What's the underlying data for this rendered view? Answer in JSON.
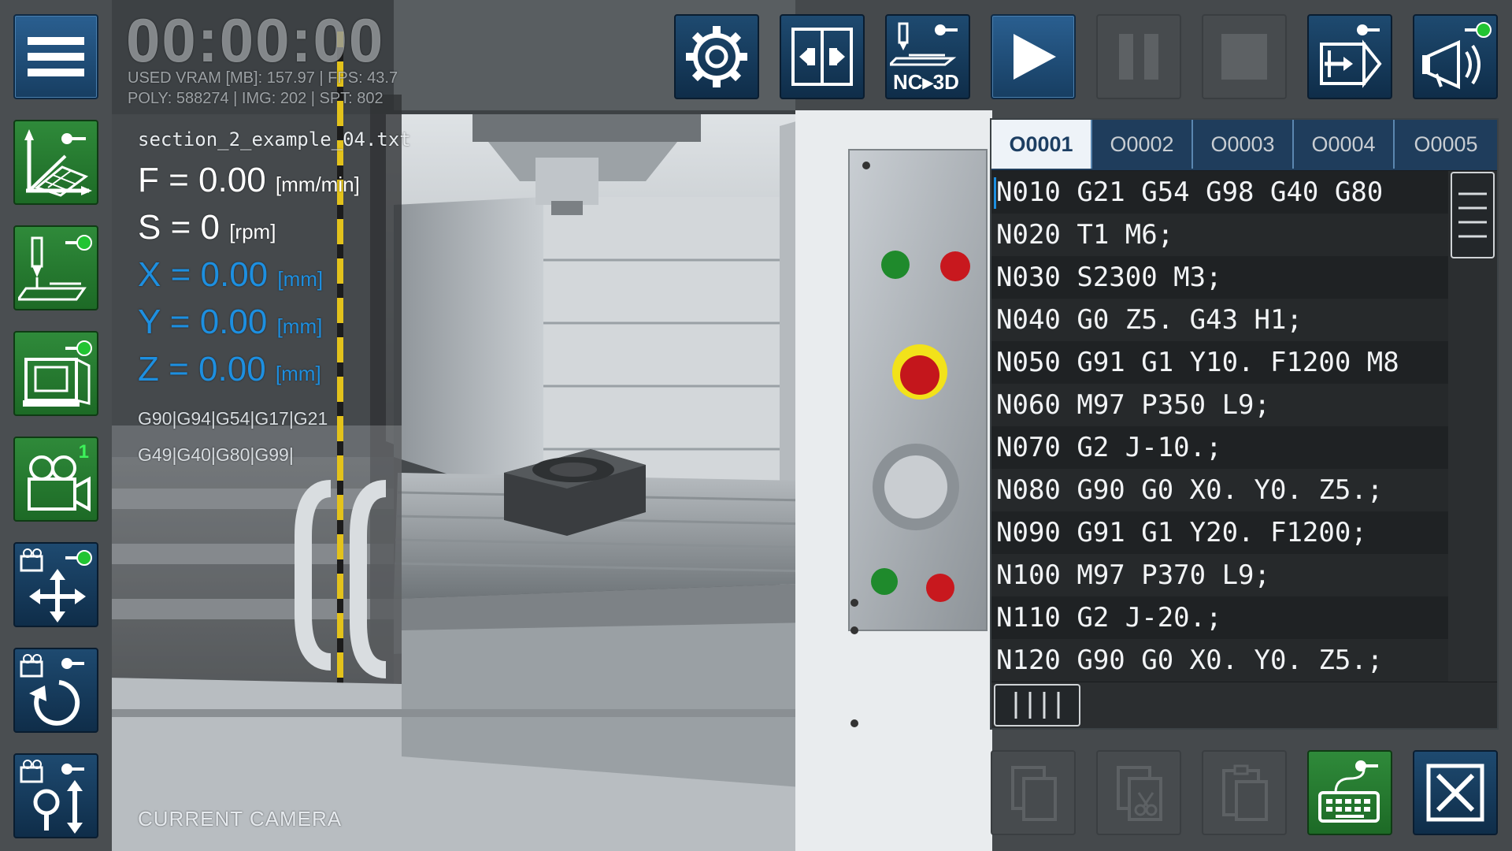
{
  "app": {
    "timer": "00:00:00",
    "stats": {
      "line1": "USED VRAM [MB]: 157.97 | FPS: 43.7",
      "line2": "POLY: 588274 | IMG: 202 | SPT: 802"
    }
  },
  "readout": {
    "filename": "section_2_example_04.txt",
    "f_label": "F = 0.00",
    "f_unit": "[mm/min]",
    "s_label": "S = 0",
    "s_unit": "[rpm]",
    "x_label": "X = 0.00",
    "x_unit": "[mm]",
    "y_label": "Y = 0.00",
    "y_unit": "[mm]",
    "z_label": "Z = 0.00",
    "z_unit": "[mm]",
    "gcodes_1": "G90|G94|G54|G17|G21",
    "gcodes_2": "G49|G40|G80|G99|",
    "camera_label": "CURRENT CAMERA"
  },
  "toolbar": {
    "nc3d_label": "NC",
    "nc3d_suffix": "3D",
    "camera_number": "1"
  },
  "tabs": [
    "O0001",
    "O0002",
    "O0003",
    "O0004",
    "O0005"
  ],
  "code_lines": [
    "N010 G21 G54 G98 G40 G80",
    "N020 T1 M6;",
    "N030 S2300 M3;",
    "N040 G0 Z5. G43 H1;",
    "N050 G91 G1 Y10. F1200 M8",
    "N060 M97 P350 L9;",
    "N070 G2 J-10.;",
    "N080 G90 G0 X0. Y0. Z5.;",
    "N090 G91 G1 Y20. F1200;",
    "N100 M97 P370 L9;",
    "N110 G2 J-20.;",
    "N120 G90 G0 X0. Y0. Z5.;"
  ],
  "colors": {
    "accent_blue": "#1d8fe0",
    "button_blue": "#1f4d78",
    "button_green": "#2f8a3a",
    "toggle_green": "#22c432",
    "editor_bg": "#1a1c1e"
  }
}
